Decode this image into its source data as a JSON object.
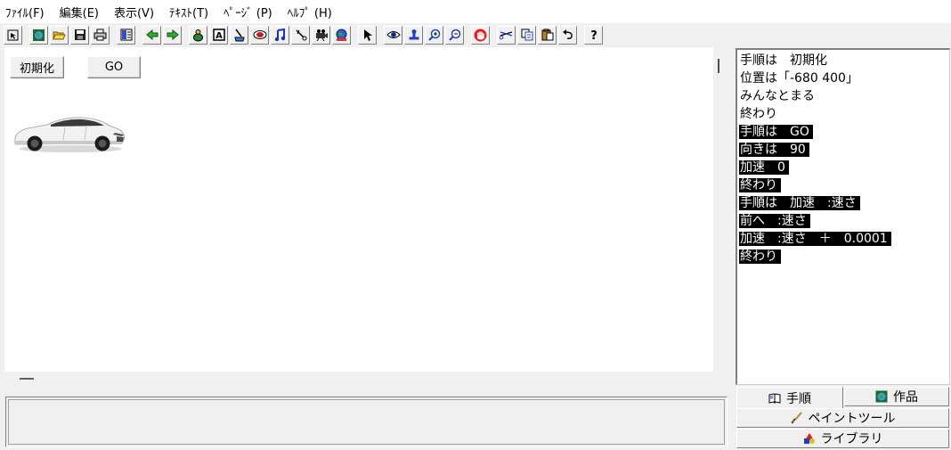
{
  "menu": {
    "file": "ﾌｧｲﾙ(F)",
    "edit": "編集(E)",
    "view": "表示(V)",
    "text": "ﾃｷｽﾄ(T)",
    "page": "ﾍﾟｰｼﾞ (P)",
    "help": "ﾍﾙﾌﾟ (H)"
  },
  "toolbar": {
    "icons": [
      "pointer-small-icon",
      "globe-icon",
      "open-folder-icon",
      "save-icon",
      "print-icon",
      "page-list-icon",
      "back-arrow-icon",
      "forward-arrow-icon",
      "turtle-icon",
      "text-box-icon",
      "brush-cup-icon",
      "eye-oval-icon",
      "music-note-icon",
      "scissors-tool-icon",
      "camera-icon",
      "globe-record-icon",
      "cursor-icon",
      "eye-icon",
      "stamp-icon",
      "zoom-in-icon",
      "zoom-out-icon",
      "hand-stop-icon",
      "cut-icon",
      "copy-icon",
      "paste-icon",
      "undo-icon",
      "help-icon"
    ]
  },
  "stage": {
    "init_label": "初期化",
    "go_label": "GO"
  },
  "script": {
    "lines": [
      {
        "text": "手順は　初期化",
        "selected": false
      },
      {
        "text": "位置は「-680 400」",
        "selected": false
      },
      {
        "text": "みんなとまる",
        "selected": false
      },
      {
        "text": "終わり",
        "selected": false
      },
      {
        "text": "手順は　GO",
        "selected": true
      },
      {
        "text": "向きは　90",
        "selected": true
      },
      {
        "text": "加速　0",
        "selected": true
      },
      {
        "text": "終わり",
        "selected": true
      },
      {
        "text": "手順は　加速　:速さ",
        "selected": true
      },
      {
        "text": "前へ　:速さ",
        "selected": true
      },
      {
        "text": "加速　:速さ　＋　0.0001",
        "selected": true
      },
      {
        "text": "終わり",
        "selected": true
      }
    ]
  },
  "tabs": {
    "script": "手順",
    "works": "作品",
    "paint": "ペイントツール",
    "library": "ライブラリ"
  },
  "colors": {
    "selection_bg": "#000000",
    "selection_fg": "#ffffff",
    "stage_bg": "#ffffff",
    "chrome_bg": "#f0f0f0"
  }
}
